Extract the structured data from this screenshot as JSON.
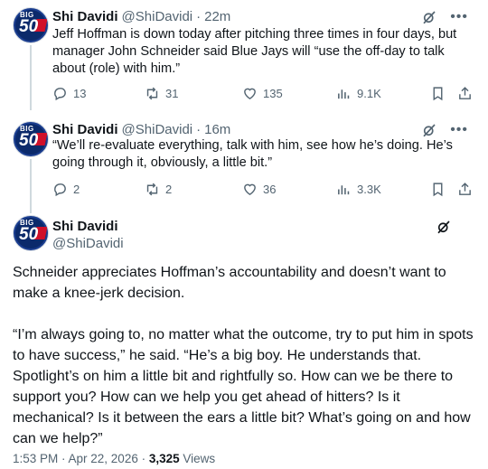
{
  "tweets": [
    {
      "name": "Shi Davidi",
      "handle": "@ShiDavidi",
      "time": "22m",
      "text": "Jeff Hoffman is down today after pitching three times in four days, but manager John Schneider said Blue Jays will “use the off-day to talk about (role) with him.”",
      "replies": "13",
      "reposts": "31",
      "likes": "135",
      "views": "9.1K"
    },
    {
      "name": "Shi Davidi",
      "handle": "@ShiDavidi",
      "time": "16m",
      "text": "“We’ll re-evaluate everything, talk with him, see how he’s doing. He’s going through it, obviously, a little bit.”",
      "replies": "2",
      "reposts": "2",
      "likes": "36",
      "views": "3.3K"
    }
  ],
  "main": {
    "name": "Shi Davidi",
    "handle": "@ShiDavidi",
    "paragraph1": "Schneider appreciates Hoffman’s accountability and doesn’t want to make a knee-jerk decision.",
    "paragraph2": "“I’m always going to, no matter what the outcome, try to put him in spots to have success,” he said. “He’s a big boy. He understands that. Spotlight’s on him a little bit and rightfully so. How can we be there to support you? How can we help you get ahead of hitters? Is it mechanical? Is it between the ears a little bit? What’s going on and how can we help?”",
    "timestamp": "1:53 PM · Apr 22, 2026 · ",
    "views_count": "3,325",
    "views_label": " Views"
  },
  "separator": "·",
  "avatar": {
    "top_text": "BIG",
    "main_text": "50"
  },
  "icons": {
    "more": "more-horizontal-icon",
    "grok": "grok-icon",
    "reply": "reply-icon",
    "repost": "repost-icon",
    "like": "heart-icon",
    "views": "views-icon",
    "bookmark": "bookmark-icon",
    "share": "share-icon"
  },
  "colors": {
    "text": "#0f1419",
    "secondary": "#536471",
    "thread_line": "#cfd9de"
  }
}
